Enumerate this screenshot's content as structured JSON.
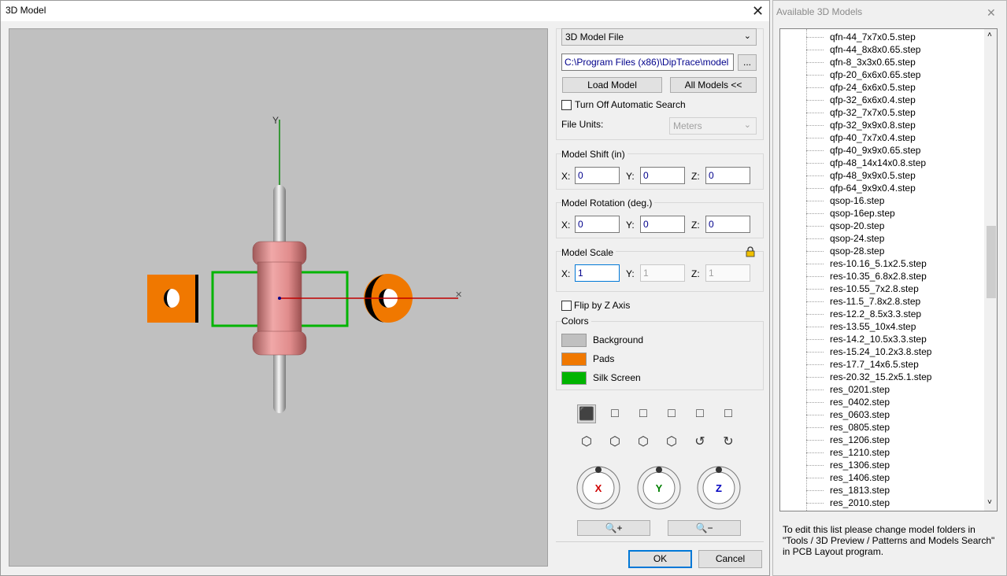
{
  "main": {
    "title": "3D Model",
    "close_glyph": "✕",
    "model_source": "3D Model File",
    "file_path": "C:\\Program Files (x86)\\DipTrace\\model",
    "browse_label": "...",
    "load_model_label": "Load Model",
    "all_models_label": "All Models <<",
    "auto_search_label": "Turn Off Automatic Search",
    "file_units_label": "File Units:",
    "file_units_value": "Meters",
    "shift": {
      "title": "Model Shift (in)",
      "x_label": "X:",
      "y_label": "Y:",
      "z_label": "Z:",
      "x": "0",
      "y": "0",
      "z": "0"
    },
    "rotation": {
      "title": "Model Rotation (deg.)",
      "x_label": "X:",
      "y_label": "Y:",
      "z_label": "Z:",
      "x": "0",
      "y": "0",
      "z": "0"
    },
    "scale": {
      "title": "Model Scale",
      "x_label": "X:",
      "y_label": "Y:",
      "z_label": "Z:",
      "x": "1",
      "y": "1",
      "z": "1"
    },
    "flip_label": "Flip by Z Axis",
    "colors": {
      "title": "Colors",
      "items": [
        {
          "label": "Background",
          "color": "#c0c0c0"
        },
        {
          "label": "Pads",
          "color": "#f07800"
        },
        {
          "label": "Silk Screen",
          "color": "#00b400"
        }
      ]
    },
    "rotate_x": "X",
    "rotate_y": "Y",
    "rotate_z": "Z",
    "axis_y_label": "Y",
    "ok_label": "OK",
    "cancel_label": "Cancel"
  },
  "side": {
    "title": "Available 3D Models",
    "close_glyph": "✕",
    "items": [
      "qfn-44_7x7x0.5.step",
      "qfn-44_8x8x0.65.step",
      "qfn-8_3x3x0.65.step",
      "qfp-20_6x6x0.65.step",
      "qfp-24_6x6x0.5.step",
      "qfp-32_6x6x0.4.step",
      "qfp-32_7x7x0.5.step",
      "qfp-32_9x9x0.8.step",
      "qfp-40_7x7x0.4.step",
      "qfp-40_9x9x0.65.step",
      "qfp-48_14x14x0.8.step",
      "qfp-48_9x9x0.5.step",
      "qfp-64_9x9x0.4.step",
      "qsop-16.step",
      "qsop-16ep.step",
      "qsop-20.step",
      "qsop-24.step",
      "qsop-28.step",
      "res-10.16_5.1x2.5.step",
      "res-10.35_6.8x2.8.step",
      "res-10.55_7x2.8.step",
      "res-11.5_7.8x2.8.step",
      "res-12.2_8.5x3.3.step",
      "res-13.55_10x4.step",
      "res-14.2_10.5x3.3.step",
      "res-15.24_10.2x3.8.step",
      "res-17.7_14x6.5.step",
      "res-20.32_15.2x5.1.step",
      "res_0201.step",
      "res_0402.step",
      "res_0603.step",
      "res_0805.step",
      "res_1206.step",
      "res_1210.step",
      "res_1306.step",
      "res_1406.step",
      "res_1813.step",
      "res_2010.step"
    ],
    "note": "To edit this list please change model folders in \"Tools / 3D Preview / Patterns and Models Search\" in PCB Layout program."
  }
}
